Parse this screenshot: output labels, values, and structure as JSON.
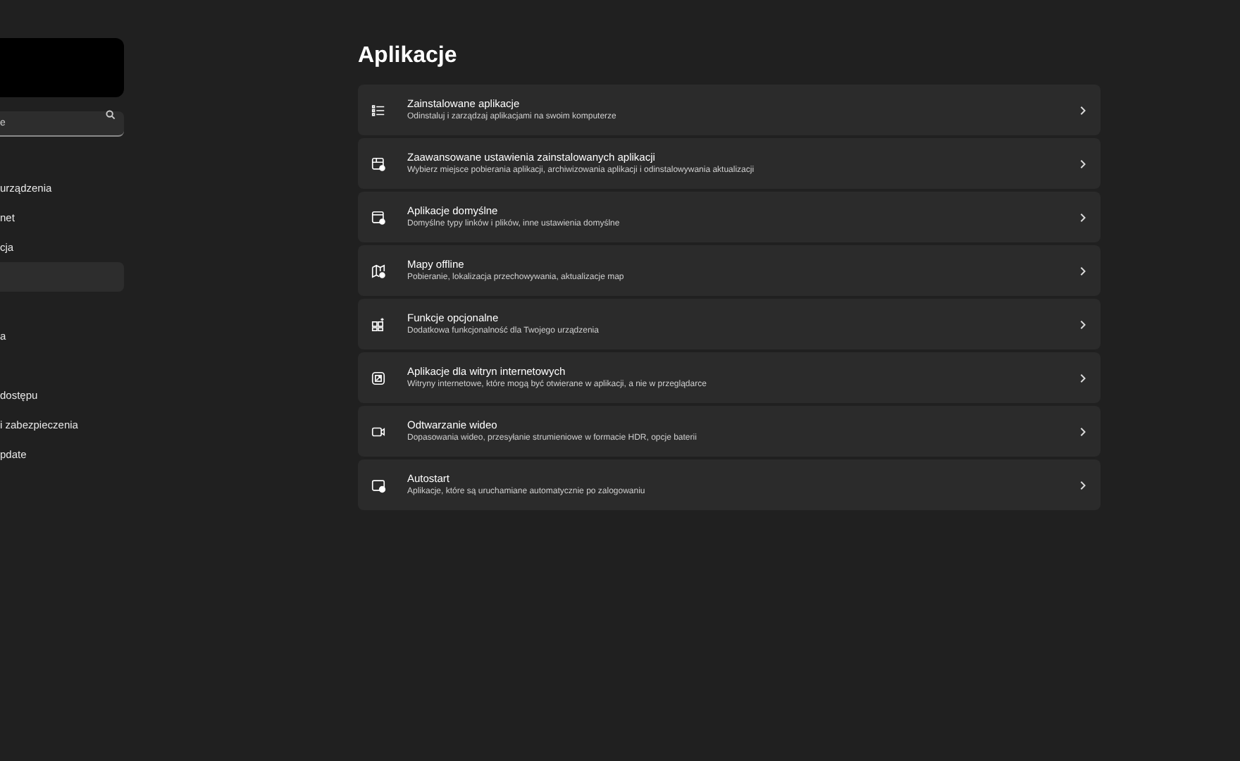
{
  "sidebar": {
    "search": {
      "placeholder": "e"
    },
    "items": [
      {
        "kind": "link",
        "label": "urządzenia",
        "selected": false
      },
      {
        "kind": "link",
        "label": "net",
        "selected": false
      },
      {
        "kind": "link",
        "label": "cja",
        "selected": false
      },
      {
        "kind": "link",
        "selected": true
      },
      {
        "kind": "blank"
      },
      {
        "kind": "link",
        "label": "a",
        "selected": false
      },
      {
        "kind": "blank"
      },
      {
        "kind": "link",
        "label": "dostępu",
        "selected": false
      },
      {
        "kind": "link",
        "label": "i zabezpieczenia",
        "selected": false
      },
      {
        "kind": "link",
        "label": "pdate",
        "selected": false
      }
    ]
  },
  "page": {
    "title": "Aplikacje",
    "cards": [
      {
        "title": "Zainstalowane aplikacje",
        "subtitle": "Odinstaluj i zarządzaj aplikacjami na swoim komputerze"
      },
      {
        "title": "Zaawansowane ustawienia zainstalowanych aplikacji",
        "subtitle": "Wybierz miejsce pobierania aplikacji, archiwizowania aplikacji i odinstalowywania aktualizacji"
      },
      {
        "title": "Aplikacje domyślne",
        "subtitle": "Domyślne typy linków i plików, inne ustawienia domyślne"
      },
      {
        "title": "Mapy offline",
        "subtitle": "Pobieranie, lokalizacja przechowywania, aktualizacje map"
      },
      {
        "title": "Funkcje opcjonalne",
        "subtitle": "Dodatkowa funkcjonalność dla Twojego urządzenia"
      },
      {
        "title": "Aplikacje dla witryn internetowych",
        "subtitle": "Witryny internetowe, które mogą być otwierane w aplikacji, a nie w przeglądarce"
      },
      {
        "title": "Odtwarzanie wideo",
        "subtitle": "Dopasowania wideo, przesyłanie strumieniowe w formacie HDR, opcje baterii"
      },
      {
        "title": "Autostart",
        "subtitle": "Aplikacje, które są uruchamiane automatycznie po zalogowaniu"
      }
    ]
  }
}
